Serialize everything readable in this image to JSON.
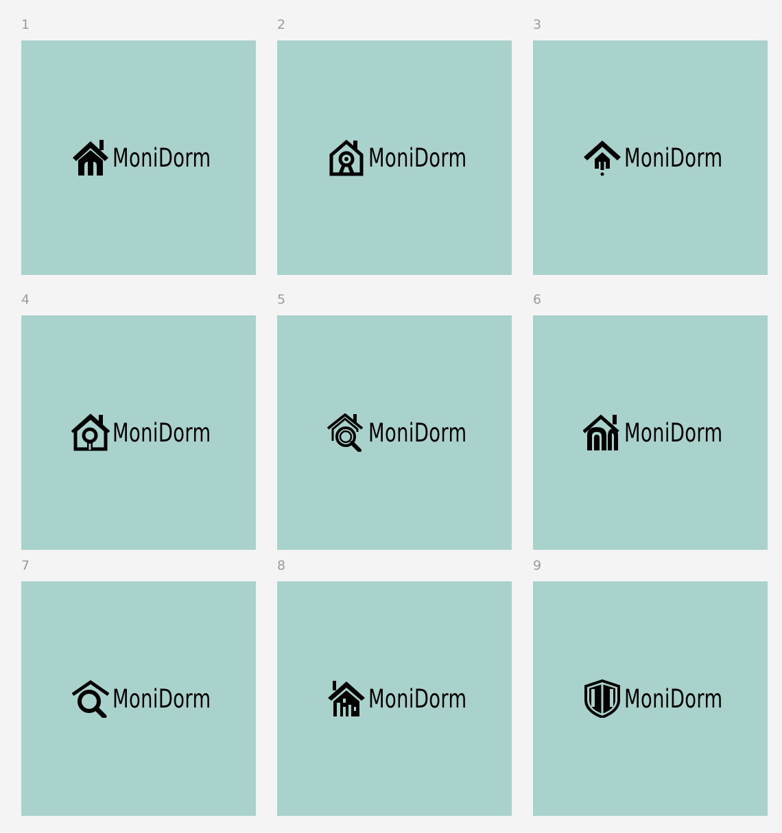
{
  "board": {
    "background": "#f4f4f4",
    "tile_color": "#a8d2cb",
    "cells": [
      {
        "number": "1",
        "brand": "MoniDorm",
        "icon": "house-solid-icon"
      },
      {
        "number": "2",
        "brand": "MoniDorm",
        "icon": "house-camera-icon"
      },
      {
        "number": "3",
        "brand": "MoniDorm",
        "icon": "roof-pin-icon"
      },
      {
        "number": "4",
        "brand": "MoniDorm",
        "icon": "house-keyhole-icon"
      },
      {
        "number": "5",
        "brand": "MoniDorm",
        "icon": "house-magnifier-icon"
      },
      {
        "number": "6",
        "brand": "MoniDorm",
        "icon": "house-arches-icon"
      },
      {
        "number": "7",
        "brand": "MoniDorm",
        "icon": "roof-magnifier-icon"
      },
      {
        "number": "8",
        "brand": "MoniDorm",
        "icon": "house-building-icon"
      },
      {
        "number": "9",
        "brand": "MoniDorm",
        "icon": "shield-icon"
      }
    ]
  }
}
